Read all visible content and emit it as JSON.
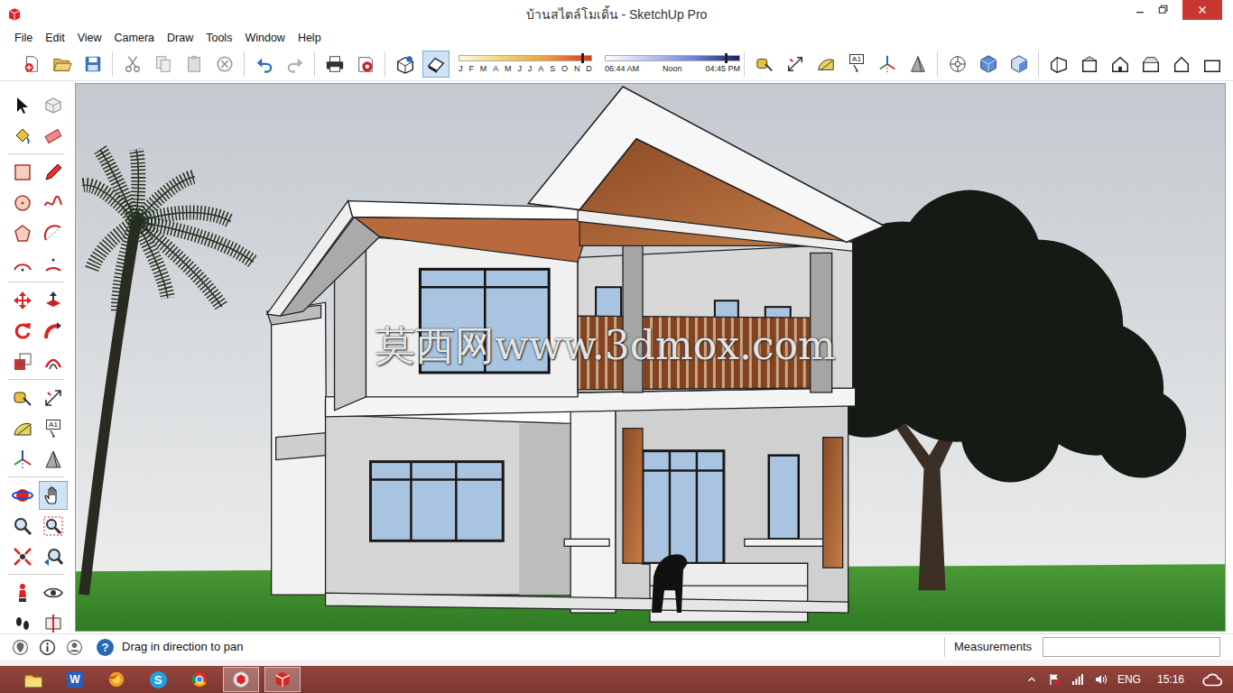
{
  "window": {
    "title": "บ้านสไตล์โมเดิ้น - SketchUp Pro"
  },
  "menu": [
    "File",
    "Edit",
    "View",
    "Camera",
    "Draw",
    "Tools",
    "Window",
    "Help"
  ],
  "toolbar": {
    "left_groups": [
      [
        {
          "selected": false
        },
        {
          "selected": false
        },
        {
          "selected": false
        }
      ],
      [
        {
          "selected": false
        },
        {
          "selected": false
        },
        {
          "selected": false
        },
        {
          "selected": false
        }
      ],
      [
        {
          "selected": false
        },
        {
          "selected": false
        }
      ],
      [
        {
          "selected": false
        },
        {
          "selected": false
        }
      ],
      [
        {
          "selected": false
        },
        {
          "selected": true
        }
      ]
    ],
    "shadow": {
      "months": [
        "J",
        "F",
        "M",
        "A",
        "M",
        "J",
        "J",
        "A",
        "S",
        "O",
        "N",
        "D"
      ],
      "date_level": 0.93,
      "times": [
        "06:44 AM",
        "Noon",
        "04:45 PM"
      ],
      "time_level": 0.9
    },
    "right_groups": [
      [
        {
          "selected": false
        },
        {
          "selected": false
        },
        {
          "selected": false
        },
        {
          "selected": false,
          "label": "A1"
        },
        {
          "selected": false
        },
        {
          "selected": false
        }
      ],
      [
        {
          "selected": false
        },
        {
          "selected": false
        },
        {
          "selected": false
        }
      ],
      [
        {
          "selected": false
        },
        {
          "selected": false
        },
        {
          "selected": false
        },
        {
          "selected": false
        },
        {
          "selected": false
        },
        {
          "selected": false
        }
      ]
    ]
  },
  "tools": [
    {
      "selected": false
    },
    {
      "selected": false
    },
    {
      "selected": false
    },
    {
      "selected": false
    },
    {
      "selected": false
    },
    {
      "selected": false
    },
    {
      "selected": false
    },
    {
      "selected": false
    },
    {
      "selected": false
    },
    {
      "selected": false
    },
    {
      "selected": false
    },
    {
      "selected": false
    },
    {
      "selected": false
    },
    {
      "selected": false
    },
    {
      "selected": false
    },
    {
      "selected": false
    },
    {
      "selected": false
    },
    {
      "selected": false
    },
    {
      "selected": false
    },
    {
      "selected": false
    },
    {
      "selected": false
    },
    {
      "selected": false,
      "label": "A1"
    },
    {
      "selected": false
    },
    {
      "selected": false
    },
    {
      "selected": false
    },
    {
      "selected": true
    },
    {
      "selected": false
    },
    {
      "selected": false
    },
    {
      "selected": false
    },
    {
      "selected": false
    },
    {
      "selected": false
    },
    {
      "selected": false
    },
    {
      "selected": false
    },
    {
      "selected": false
    }
  ],
  "watermark": "莫西网www.3dmox.com",
  "status_bar": {
    "help": "?",
    "hint": "Drag in direction to pan",
    "measurements_label": "Measurements",
    "measurements_value": ""
  },
  "taskbar": {
    "apps": [
      {
        "selected": false
      },
      {
        "label": "W",
        "selected": false
      },
      {
        "selected": false
      },
      {
        "label": "S",
        "selected": false
      },
      {
        "selected": false
      },
      {
        "selected": true
      },
      {
        "selected": true
      }
    ],
    "language": "ENG",
    "clock": "15:16"
  }
}
